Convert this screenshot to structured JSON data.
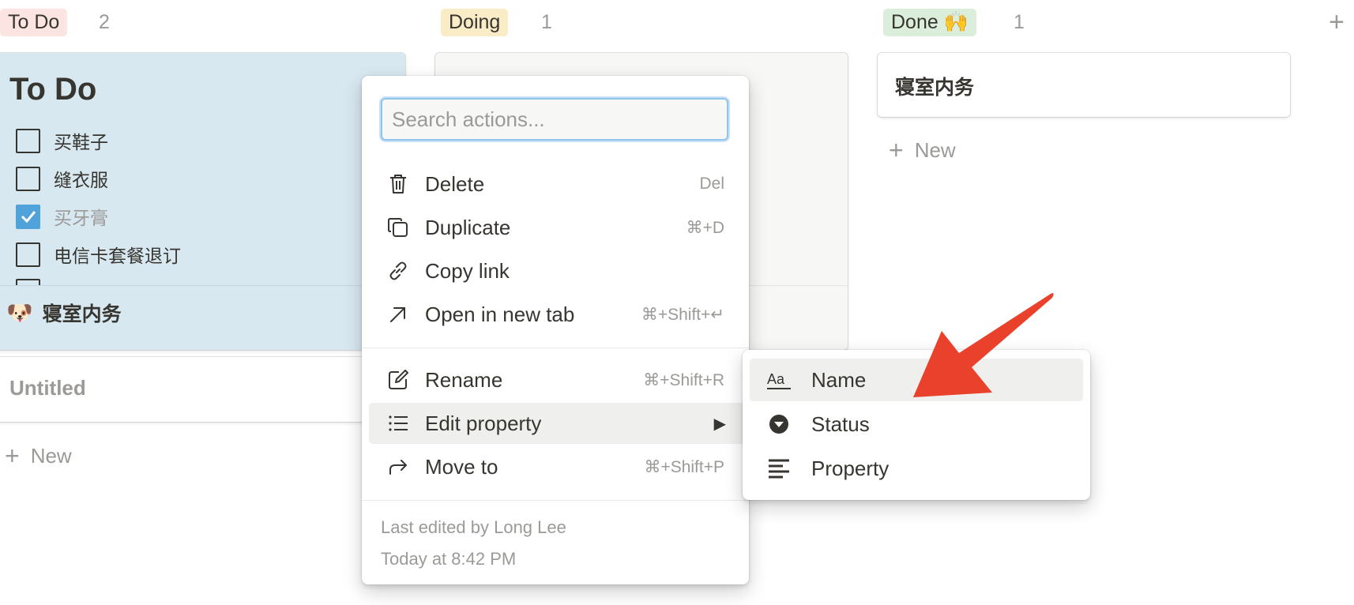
{
  "board": {
    "columns": [
      {
        "name": "To Do",
        "count": "2",
        "tag_bg": "#fbe4e2"
      },
      {
        "name": "Doing",
        "count": "1",
        "tag_bg": "#fbecc8"
      },
      {
        "name": "Done 🙌",
        "count": "1",
        "tag_bg": "#dbeddb"
      }
    ],
    "add_column_glyph": "+"
  },
  "todo_card": {
    "heading": "To Do",
    "items": [
      {
        "text": "买鞋子",
        "checked": false
      },
      {
        "text": "缝衣服",
        "checked": false
      },
      {
        "text": "买牙膏",
        "checked": true
      },
      {
        "text": "电信卡套餐退订",
        "checked": false
      }
    ],
    "title_emoji": "🐶",
    "title": "寝室内务"
  },
  "untitled_card": {
    "title": "Untitled"
  },
  "done_card": {
    "title": "寝室内务"
  },
  "new_label": "New",
  "context_menu": {
    "search": {
      "placeholder": "Search actions..."
    },
    "items": [
      {
        "label": "Delete",
        "shortcut": "Del",
        "icon": "trash-icon"
      },
      {
        "label": "Duplicate",
        "shortcut": "⌘+D",
        "icon": "duplicate-icon"
      },
      {
        "label": "Copy link",
        "shortcut": "",
        "icon": "link-icon"
      },
      {
        "label": "Open in new tab",
        "shortcut": "⌘+Shift+↵",
        "icon": "arrow-up-right-icon"
      },
      {
        "label": "Rename",
        "shortcut": "⌘+Shift+R",
        "icon": "edit-icon"
      },
      {
        "label": "Edit property",
        "shortcut": "▶",
        "icon": "list-icon"
      },
      {
        "label": "Move to",
        "shortcut": "⌘+Shift+P",
        "icon": "forward-arrow-icon"
      }
    ],
    "last_edited": "Last edited by Long Lee",
    "edited_time": "Today at 8:42 PM"
  },
  "property_submenu": {
    "items": [
      {
        "label": "Name",
        "icon": "text-aa-icon"
      },
      {
        "label": "Status",
        "icon": "status-circle-icon"
      },
      {
        "label": "Property",
        "icon": "text-lines-icon"
      }
    ]
  },
  "colors": {
    "todo_card_bg": "#d8e8f1",
    "checkbox_checked": "#4fa3d9",
    "annotation_arrow": "#e9412b",
    "hover_bg": "#efefed"
  }
}
